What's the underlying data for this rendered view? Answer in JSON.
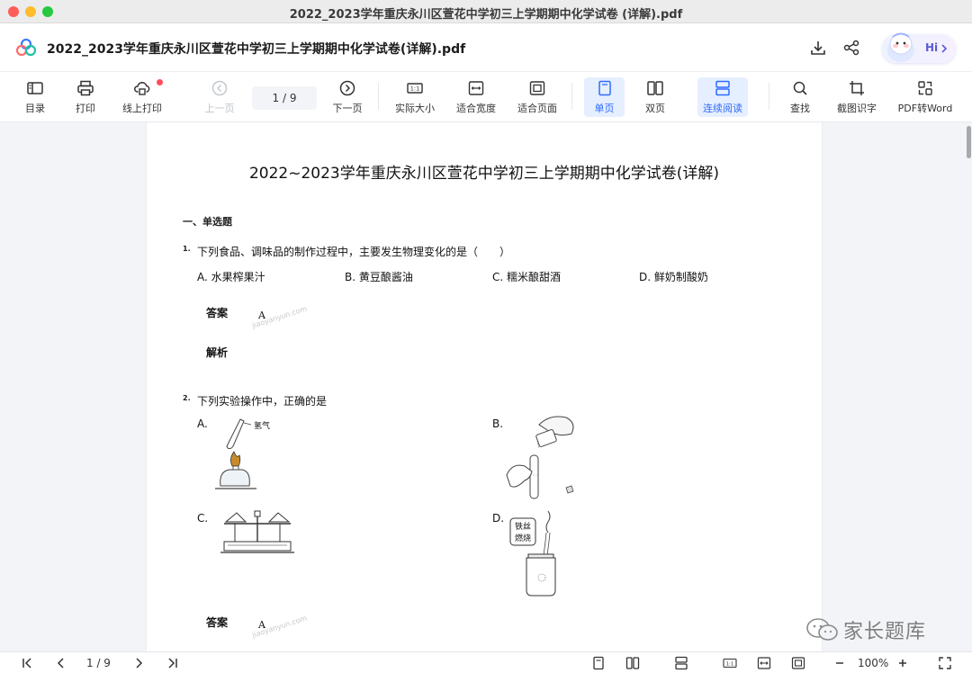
{
  "window": {
    "title": "2022_2023学年重庆永川区萱花中学初三上学期期中化学试卷 (详解).pdf"
  },
  "header": {
    "doc_name": "2022_2023学年重庆永川区萱花中学初三上学期期中化学试卷(详解).pdf",
    "assistant_label": "Hi",
    "icons": [
      "download-icon",
      "share-icon"
    ]
  },
  "toolbar": {
    "toc": "目录",
    "print": "打印",
    "online_print": "线上打印",
    "prev_page": "上一页",
    "page_indicator": "1  /  9",
    "next_page": "下一页",
    "actual_size": "实际大小",
    "fit_width": "适合宽度",
    "fit_page": "适合页面",
    "single_page": "单页",
    "double_page": "双页",
    "continuous": "连续阅读",
    "search": "查找",
    "ocr": "截图识字",
    "to_word": "PDF转Word"
  },
  "document": {
    "title": "2022~2023学年重庆永川区萱花中学初三上学期期中化学试卷(详解)",
    "section": "一、单选题",
    "q1": {
      "num": "1.",
      "text": "下列食品、调味品的制作过程中，主要发生物理变化的是（　　）",
      "options": [
        "A. 水果榨果汁",
        "B. 黄豆酿酱油",
        "C. 糯米酿甜酒",
        "D. 鲜奶制酸奶"
      ],
      "answer_label": "答案",
      "answer": "A",
      "analysis_label": "解析"
    },
    "q2": {
      "num": "2.",
      "text": "下列实验操作中，正确的是",
      "options": [
        "A.",
        "B.",
        "C.",
        "D."
      ],
      "fig_a_label": "氢气",
      "fig_d_label_1": "铁丝",
      "fig_d_label_2": "燃烧",
      "answer_label": "答案",
      "answer": "A"
    },
    "watermark": "jiaoyanyun.com"
  },
  "brand": {
    "text": "家长题库"
  },
  "bottombar": {
    "page_indicator": "1  /  9",
    "zoom": "100%"
  }
}
